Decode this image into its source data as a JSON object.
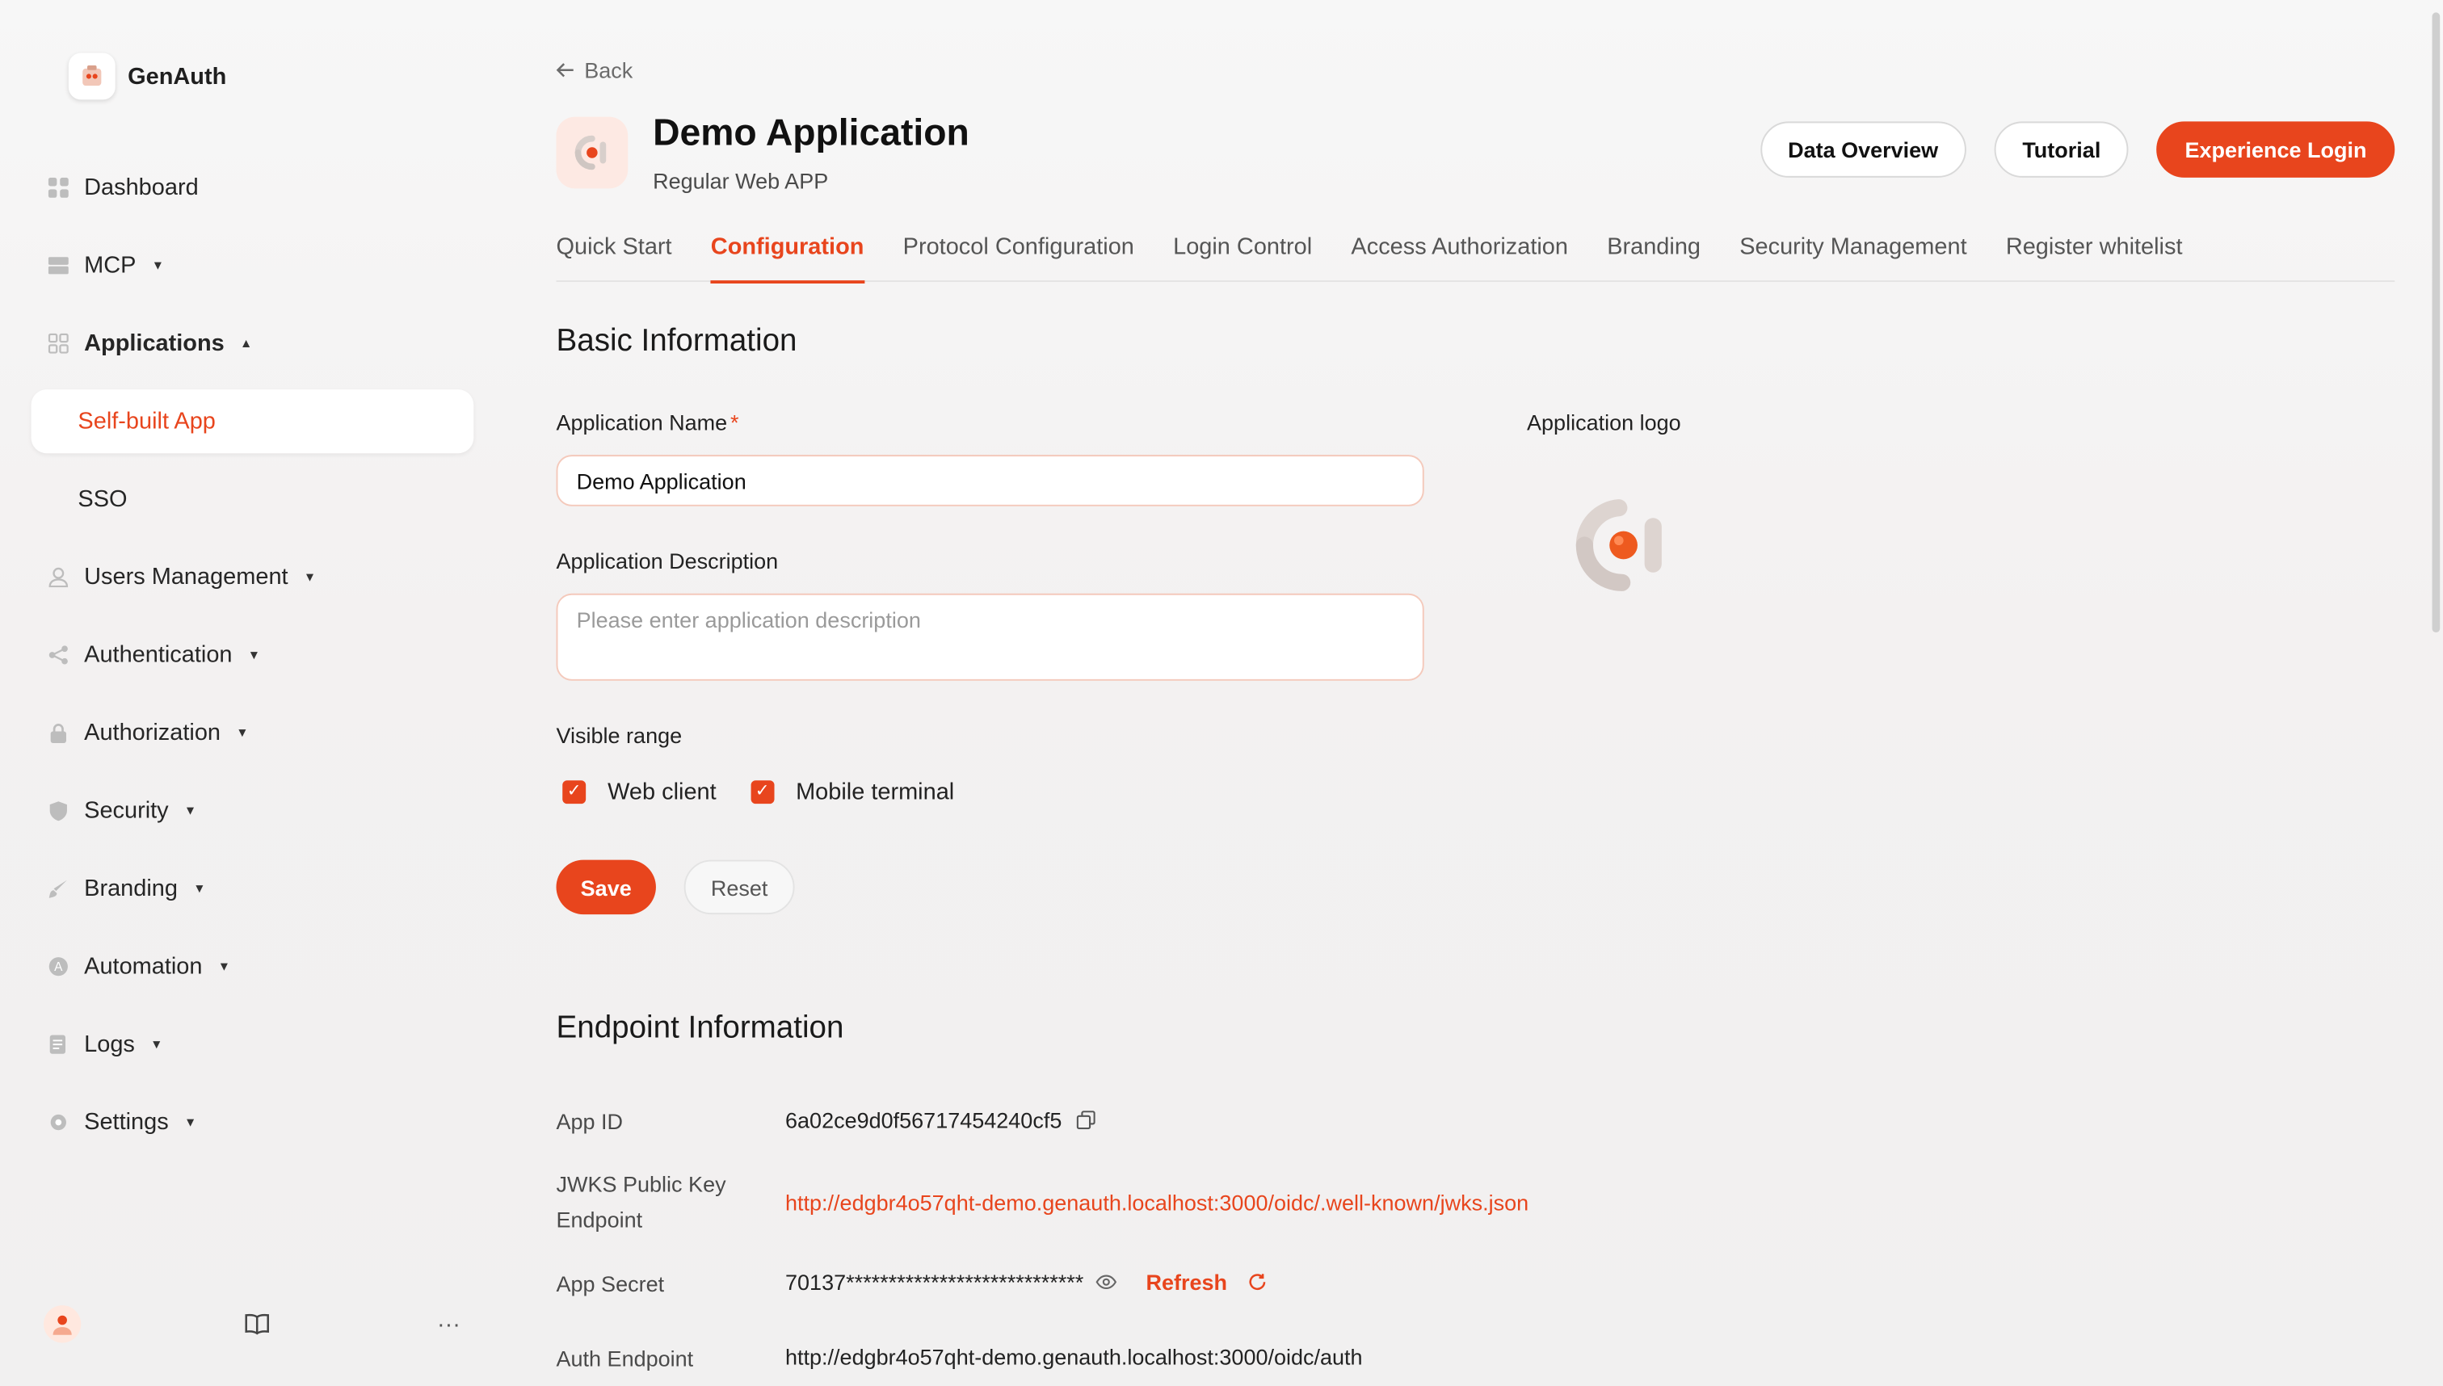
{
  "brand": {
    "name": "GenAuth"
  },
  "sidebar": {
    "items": [
      {
        "label": "Dashboard",
        "icon": "grid-icon",
        "caret": false
      },
      {
        "label": "MCP",
        "icon": "server-icon",
        "caret": true
      },
      {
        "label": "Applications",
        "icon": "apps-icon",
        "caret": true,
        "expanded": true
      },
      {
        "label": "Users Management",
        "icon": "user-icon",
        "caret": true
      },
      {
        "label": "Authentication",
        "icon": "share-icon",
        "caret": true
      },
      {
        "label": "Authorization",
        "icon": "lock-icon",
        "caret": true
      },
      {
        "label": "Security",
        "icon": "shield-icon",
        "caret": true
      },
      {
        "label": "Branding",
        "icon": "brush-icon",
        "caret": true
      },
      {
        "label": "Automation",
        "icon": "automation-icon",
        "caret": true
      },
      {
        "label": "Logs",
        "icon": "log-icon",
        "caret": true
      },
      {
        "label": "Settings",
        "icon": "gear-icon",
        "caret": true
      }
    ],
    "sub_items": [
      {
        "label": "Self-built App",
        "active": true
      },
      {
        "label": "SSO",
        "active": false
      }
    ],
    "footer": {
      "more": "···"
    }
  },
  "header": {
    "back_label": "Back",
    "title": "Demo Application",
    "subtitle": "Regular Web APP",
    "actions": {
      "data_overview": "Data Overview",
      "tutorial": "Tutorial",
      "experience_login": "Experience Login"
    }
  },
  "tabs": [
    {
      "label": "Quick Start",
      "active": false
    },
    {
      "label": "Configuration",
      "active": true
    },
    {
      "label": "Protocol Configuration",
      "active": false
    },
    {
      "label": "Login Control",
      "active": false
    },
    {
      "label": "Access Authorization",
      "active": false
    },
    {
      "label": "Branding",
      "active": false
    },
    {
      "label": "Security Management",
      "active": false
    },
    {
      "label": "Register whitelist",
      "active": false
    }
  ],
  "basic": {
    "title": "Basic Information",
    "name_label": "Application Name",
    "required_mark": "*",
    "name_value": "Demo Application",
    "desc_label": "Application Description",
    "desc_placeholder": "Please enter application description",
    "visible_label": "Visible range",
    "web_client": "Web client",
    "mobile_terminal": "Mobile terminal",
    "web_checked": true,
    "mobile_checked": true,
    "save": "Save",
    "reset": "Reset",
    "logo_label": "Application logo"
  },
  "endpoint": {
    "title": "Endpoint Information",
    "app_id_label": "App ID",
    "app_id_value": "6a02ce9d0f56717454240cf5",
    "jwks_label_1": "JWKS Public Key",
    "jwks_label_2": "Endpoint",
    "jwks_value": "http://edgbr4o57qht-demo.genauth.localhost:3000/oidc/.well-known/jwks.json",
    "secret_label": "App Secret",
    "secret_value": "70137****************************",
    "refresh": "Refresh",
    "auth_label": "Auth Endpoint",
    "auth_value": "http://edgbr4o57qht-demo.genauth.localhost:3000/oidc/auth"
  },
  "colors": {
    "accent": "#e8451d",
    "input_border": "#f4c9bb"
  }
}
